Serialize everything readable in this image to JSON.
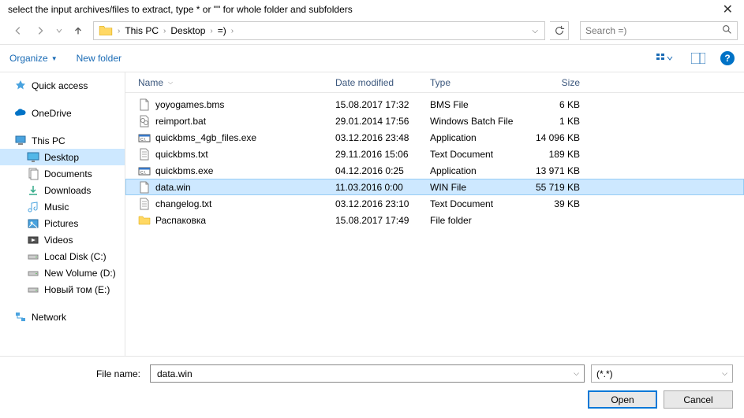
{
  "title": "select the input archives/files to extract, type * or \"\" for whole folder and subfolders",
  "breadcrumbs": [
    "This PC",
    "Desktop",
    "=)"
  ],
  "search_placeholder": "Search =)",
  "toolbar": {
    "organize": "Organize",
    "new_folder": "New folder"
  },
  "columns": {
    "name": "Name",
    "date": "Date modified",
    "type": "Type",
    "size": "Size"
  },
  "tree": {
    "quick_access": "Quick access",
    "onedrive": "OneDrive",
    "this_pc": "This PC",
    "desktop": "Desktop",
    "documents": "Documents",
    "downloads": "Downloads",
    "music": "Music",
    "pictures": "Pictures",
    "videos": "Videos",
    "local_disk": "Local Disk (C:)",
    "new_volume": "New Volume (D:)",
    "novyy_tom": "Новый том (E:)",
    "network": "Network"
  },
  "files": [
    {
      "icon": "file",
      "name": "yoyogames.bms",
      "date": "15.08.2017 17:32",
      "type": "BMS File",
      "size": "6 KB",
      "selected": false
    },
    {
      "icon": "bat",
      "name": "reimport.bat",
      "date": "29.01.2014 17:56",
      "type": "Windows Batch File",
      "size": "1 KB",
      "selected": false
    },
    {
      "icon": "exe",
      "name": "quickbms_4gb_files.exe",
      "date": "03.12.2016 23:48",
      "type": "Application",
      "size": "14 096 KB",
      "selected": false
    },
    {
      "icon": "txt",
      "name": "quickbms.txt",
      "date": "29.11.2016 15:06",
      "type": "Text Document",
      "size": "189 KB",
      "selected": false
    },
    {
      "icon": "exe",
      "name": "quickbms.exe",
      "date": "04.12.2016 0:25",
      "type": "Application",
      "size": "13 971 KB",
      "selected": false
    },
    {
      "icon": "file",
      "name": "data.win",
      "date": "11.03.2016 0:00",
      "type": "WIN File",
      "size": "55 719 KB",
      "selected": true
    },
    {
      "icon": "txt",
      "name": "changelog.txt",
      "date": "03.12.2016 23:10",
      "type": "Text Document",
      "size": "39 KB",
      "selected": false
    },
    {
      "icon": "folder",
      "name": "Распаковка",
      "date": "15.08.2017 17:49",
      "type": "File folder",
      "size": "",
      "selected": false
    }
  ],
  "filename_label": "File name:",
  "filename_value": "data.win",
  "filter_value": "(*.*)",
  "buttons": {
    "open": "Open",
    "cancel": "Cancel"
  }
}
